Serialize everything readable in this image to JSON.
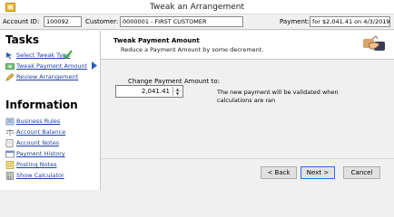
{
  "window": {
    "title": "Tweak an Arrangement"
  },
  "infobar": {
    "account_id_label": "Account ID:",
    "account_id_value": "100092",
    "customer_label": "Customer:",
    "customer_value": "0000001 - FIRST CUSTOMER",
    "payment_label": "Payment:",
    "payment_value": "for $2,041.41 on 4/3/2019"
  },
  "sidebar": {
    "tasks_title": "Tasks",
    "tasks": [
      {
        "label": "Select Tweak Type",
        "icon": "arrow-select-icon"
      },
      {
        "label": "Tweak Payment Amount",
        "icon": "money-icon"
      },
      {
        "label": "Review Arrangement",
        "icon": "pencil-icon"
      }
    ],
    "information_title": "Information",
    "information": [
      {
        "label": "Business Rules",
        "icon": "rules-icon"
      },
      {
        "label": "Account Balance",
        "icon": "balance-icon"
      },
      {
        "label": "Account Notes",
        "icon": "notes-icon"
      },
      {
        "label": "Payment History",
        "icon": "history-icon"
      },
      {
        "label": "Posting Notes",
        "icon": "posting-icon"
      },
      {
        "label": "Show Calculator",
        "icon": "calculator-icon"
      }
    ]
  },
  "main": {
    "title": "Tweak Payment Amount",
    "subtitle": "Reduce a Payment Amount by some decrement.",
    "amount_label": "Change Payment Amount to:",
    "amount_value": "2,041.41",
    "note": "The new payment will be validated when calculations are ran"
  },
  "buttons": {
    "back": "< Back",
    "next": "Next >",
    "cancel": "Cancel"
  },
  "colors": {
    "link": "#1a3fa6",
    "check": "#3aa53a",
    "focus_border": "#2a6fdb"
  }
}
